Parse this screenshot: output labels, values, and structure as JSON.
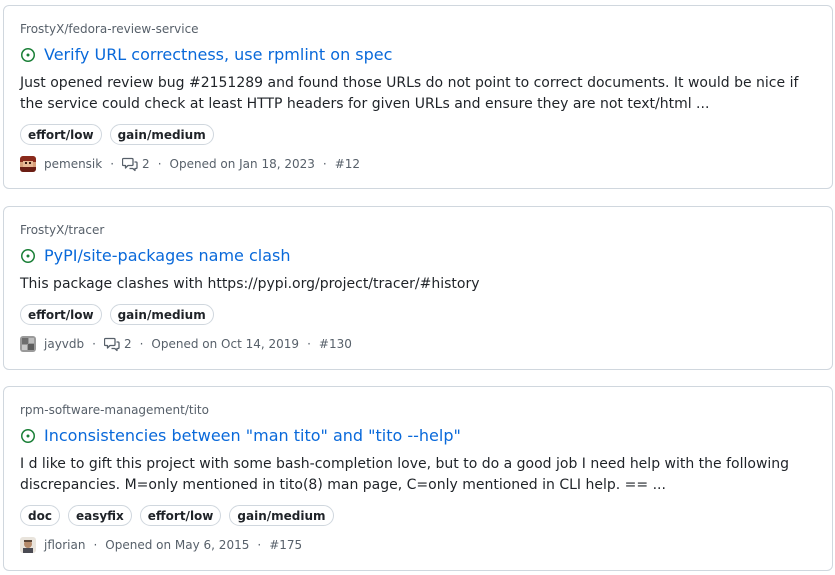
{
  "issues": [
    {
      "repo": "FrostyX/fedora-review-service",
      "title": "Verify URL correctness, use rpmlint on spec",
      "body": "Just opened review bug #2151289 and found those URLs do not point to correct documents. It would be nice if the service could check at least HTTP headers for given URLs and ensure they are not text/html ...",
      "labels": [
        "effort/low",
        "gain/medium"
      ],
      "author": "pemensik",
      "comments": "2",
      "opened": "Opened on Jan 18, 2023",
      "number": "#12"
    },
    {
      "repo": "FrostyX/tracer",
      "title": "PyPI/site-packages name clash",
      "body": "This package clashes with https://pypi.org/project/tracer/#history",
      "labels": [
        "effort/low",
        "gain/medium"
      ],
      "author": "jayvdb",
      "comments": "2",
      "opened": "Opened on Oct 14, 2019",
      "number": "#130"
    },
    {
      "repo": "rpm-software-management/tito",
      "title": "Inconsistencies between \"man tito\" and \"tito --help\"",
      "body": "I d like to gift this project with some bash-completion love, but to do a good job I need help with the following discrepancies. M=only mentioned in tito(8) man page, C=only mentioned in CLI help. == ...",
      "labels": [
        "doc",
        "easyfix",
        "effort/low",
        "gain/medium"
      ],
      "author": "jflorian",
      "opened": "Opened on May 6, 2015",
      "number": "#175"
    }
  ],
  "colors": {
    "open_icon": "#1a7f37",
    "link": "#0969da",
    "muted": "#57606a",
    "border": "#d0d7de"
  },
  "icons": {
    "open": "issue-opened-icon",
    "comments": "comment-discussion-icon"
  }
}
